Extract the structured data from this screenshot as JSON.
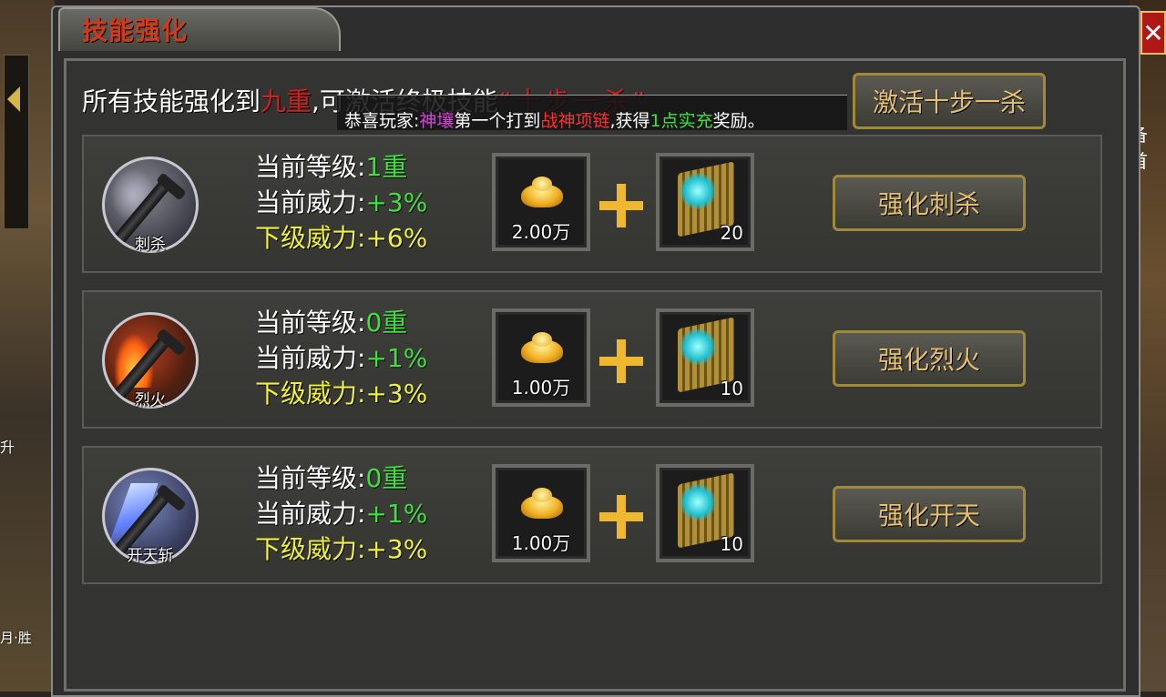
{
  "window": {
    "title": "技能强化",
    "close_glyph": "✕"
  },
  "banner": {
    "prefix": "所有技能强化到",
    "level": "九重",
    "middle": ",可激活终极技能",
    "ultimate": "“十步一杀”",
    "activate_label": "激活十步一杀"
  },
  "ticker": {
    "prefix": "恭喜玩家:",
    "player": "神壤",
    "middle": "第一个打到",
    "item": "战神项链",
    "mid2": ",获得",
    "reward": "1点实充",
    "suffix": "奖励。"
  },
  "labels": {
    "current_level": "当前等级:",
    "current_power": "当前威力:",
    "next_power": "下级威力:"
  },
  "skills": [
    {
      "name": "刺杀",
      "icon": "assassinate-skill-icon",
      "level": "1重",
      "power": "+3%",
      "next": "+6%",
      "gold_cost": "2.00万",
      "scroll_cost": "20",
      "button": "强化刺杀"
    },
    {
      "name": "烈火",
      "icon": "blazing-fire-skill-icon",
      "level": "0重",
      "power": "+1%",
      "next": "+3%",
      "gold_cost": "1.00万",
      "scroll_cost": "10",
      "button": "强化烈火"
    },
    {
      "name": "开天斩",
      "icon": "sky-splitting-slash-skill-icon",
      "level": "0重",
      "power": "+1%",
      "next": "+3%",
      "gold_cost": "1.00万",
      "scroll_cost": "10",
      "button": "强化开天"
    }
  ],
  "scene": {
    "right_label": "备首",
    "left_text_1": "升",
    "left_text_2": "月·胜"
  },
  "colors": {
    "title": "#d23a1a",
    "button_text": "#e6c070",
    "green": "#40e040",
    "yellow": "#f0f040",
    "red": "#d22020"
  }
}
